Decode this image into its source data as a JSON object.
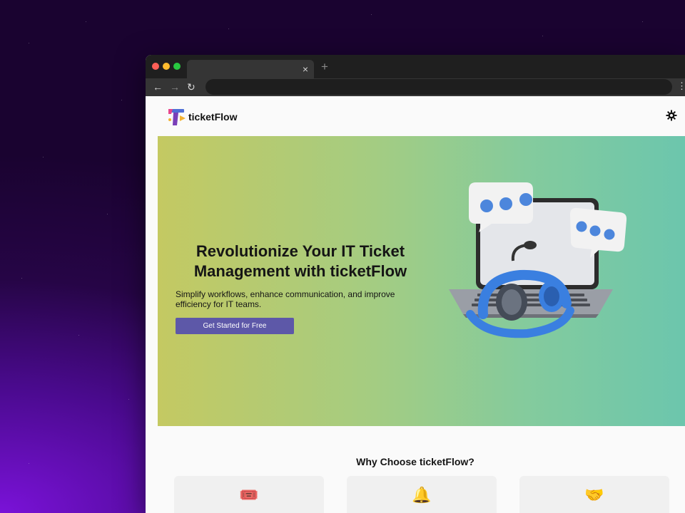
{
  "browser": {
    "tab_close": "×",
    "new_tab": "+",
    "nav": {
      "back": "←",
      "forward": "→",
      "reload": "↻",
      "menu": "⋮"
    }
  },
  "site": {
    "brand": "ticketFlow",
    "hero": {
      "title": "Revolutionize Your IT Ticket Management with ticketFlow",
      "subtitle": "Simplify workflows, enhance communication, and improve efficiency for IT teams.",
      "cta_label": "Get Started for Free"
    },
    "why": {
      "title": "Why Choose ticketFlow?",
      "features": [
        {
          "icon": "ticket-icon",
          "glyph": "🎟️"
        },
        {
          "icon": "bell-icon",
          "glyph": "🔔"
        },
        {
          "icon": "handshake-icon",
          "glyph": "🤝"
        }
      ]
    }
  },
  "colors": {
    "accent": "#5d58a8",
    "hero_gradient_start": "#c4c962",
    "hero_gradient_end": "#6cc6ad",
    "background_purple": "#7a12d8"
  }
}
